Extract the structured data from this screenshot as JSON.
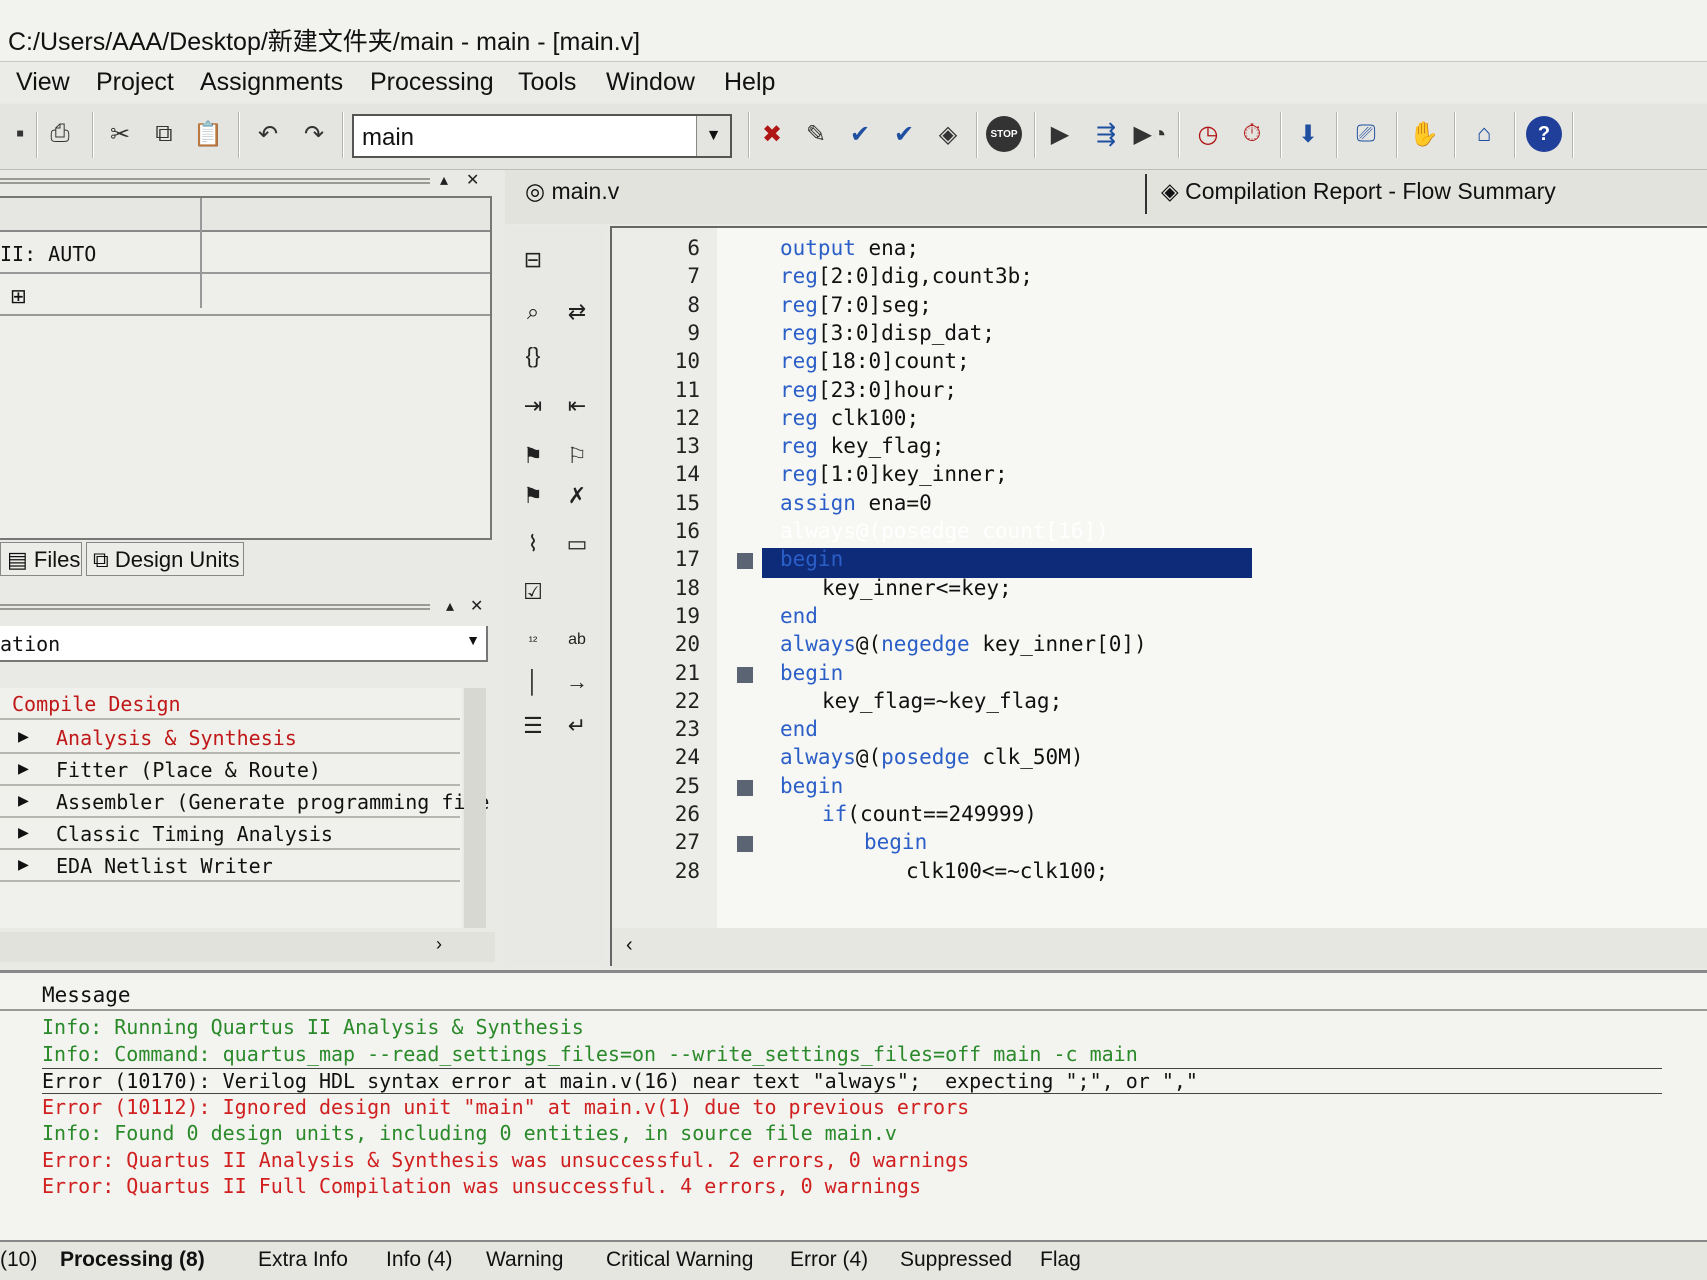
{
  "window": {
    "title": "C:/Users/AAA/Desktop/新建文件夹/main - main - [main.v]"
  },
  "menu": [
    "View",
    "Project",
    "Assignments",
    "Processing",
    "Tools",
    "Window",
    "Help"
  ],
  "toolbar": {
    "entity_value": "main",
    "stop_label": "STOP",
    "help_label": "?"
  },
  "project_navigator": {
    "rows": [
      "II: AUTO",
      ""
    ],
    "tabs": [
      "Files",
      "Design Units"
    ]
  },
  "tasks": {
    "selected": "ation",
    "items": [
      "Compile Design",
      "Analysis & Synthesis",
      "Fitter (Place & Route)",
      "Assembler (Generate programming file",
      "Classic Timing Analysis",
      "EDA Netlist Writer"
    ]
  },
  "editor": {
    "tabs": [
      "main.v",
      "Compilation Report - Flow Summary"
    ],
    "lines": [
      {
        "n": "6",
        "text": "output ena;"
      },
      {
        "n": "7",
        "text": "reg[2:0]dig,count3b;"
      },
      {
        "n": "8",
        "text": "reg[7:0]seg;"
      },
      {
        "n": "9",
        "text": "reg[3:0]disp_dat;"
      },
      {
        "n": "10",
        "text": "reg[18:0]count;"
      },
      {
        "n": "11",
        "text": "reg[23:0]hour;"
      },
      {
        "n": "12",
        "text": "reg clk100;"
      },
      {
        "n": "13",
        "text": "reg key_flag;"
      },
      {
        "n": "14",
        "text": "reg[1:0]key_inner;"
      },
      {
        "n": "15",
        "text": "assign ena=0"
      },
      {
        "n": "16",
        "text": "always@(posedge count[16])"
      },
      {
        "n": "17",
        "text": "begin"
      },
      {
        "n": "18",
        "text": "key_inner<=key;"
      },
      {
        "n": "19",
        "text": "end"
      },
      {
        "n": "20",
        "text": "always@(negedge key_inner[0])"
      },
      {
        "n": "21",
        "text": "begin"
      },
      {
        "n": "22",
        "text": "key_flag=~key_flag;"
      },
      {
        "n": "23",
        "text": "end"
      },
      {
        "n": "24",
        "text": "always@(posedge clk_50M)"
      },
      {
        "n": "25",
        "text": "begin"
      },
      {
        "n": "26",
        "text": "if(count==249999)"
      },
      {
        "n": "27",
        "text": "begin"
      },
      {
        "n": "28",
        "text": "clk100<=~clk100;"
      }
    ]
  },
  "messages": {
    "header": "Message",
    "items": [
      {
        "type": "info",
        "text": "Info: Running Quartus II Analysis & Synthesis"
      },
      {
        "type": "info",
        "text": "Info: Command: quartus_map --read_settings_files=on --write_settings_files=off main -c main"
      },
      {
        "type": "error-selected",
        "text": "Error (10170): Verilog HDL syntax error at main.v(16) near text \"always\";  expecting \";\", or \",\""
      },
      {
        "type": "error",
        "text": "Error (10112): Ignored design unit \"main\" at main.v(1) due to previous errors"
      },
      {
        "type": "info",
        "text": "Info: Found 0 design units, including 0 entities, in source file main.v"
      },
      {
        "type": "error",
        "text": "Error: Quartus II Analysis & Synthesis was unsuccessful. 2 errors, 0 warnings"
      },
      {
        "type": "error",
        "text": "Error: Quartus II Full Compilation was unsuccessful. 4 errors, 0 warnings"
      }
    ],
    "tabs": [
      "(10)",
      "Processing (8)",
      "Extra Info",
      "Info (4)",
      "Warning",
      "Critical Warning",
      "Error (4)",
      "Suppressed",
      "Flag"
    ]
  },
  "colors": {
    "keyword": "#2b5fc7",
    "selection": "#0d2b78",
    "info": "#2a8a2a",
    "error": "#d02020"
  }
}
